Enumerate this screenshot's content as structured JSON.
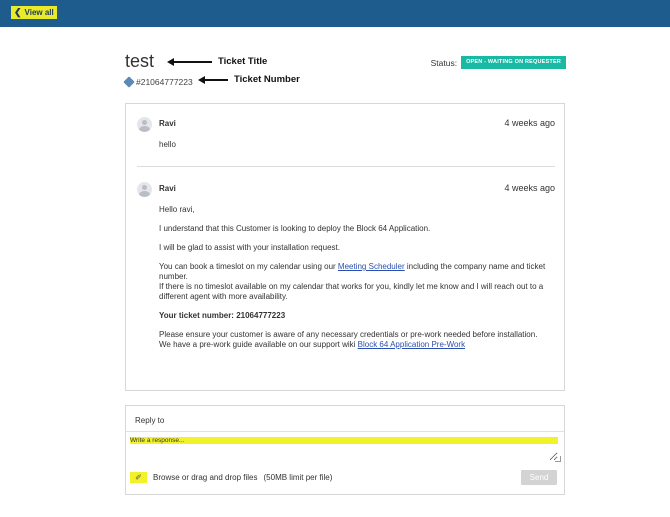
{
  "topbar": {
    "view_all_label": "View all"
  },
  "ticket": {
    "title": "test",
    "number": "#21064777223"
  },
  "annotations": {
    "title_label": "Ticket Title",
    "number_label": "Ticket Number"
  },
  "status": {
    "label": "Status:",
    "badge": "OPEN - WAITING ON REQUESTER",
    "badge_color": "#1ab9a4"
  },
  "messages": [
    {
      "author": "Ravi",
      "time": "4 weeks ago",
      "lines": [
        "hello"
      ]
    },
    {
      "author": "Ravi",
      "time": "4 weeks ago",
      "greeting": "Hello ravi,",
      "p1": "I understand that this Customer is looking to deploy the Block 64 Application.",
      "p2": "I will be glad to assist with your installation request.",
      "p3_pre": "You can book a timeslot on my calendar using our ",
      "p3_link": "Meeting Scheduler",
      "p3_post": " including the company name and ticket number.",
      "p3b": "If there is no timeslot available on my calendar that works for you, kindly let me know and I will reach out to a different agent with more availability.",
      "p4": "Your ticket number: 21064777223",
      "p5": "Please ensure your customer is aware of any necessary credentials or pre-work needed before installation.",
      "p6_pre": "We have a pre-work guide available on our support wiki ",
      "p6_link": "Block 64 Application Pre-Work"
    }
  ],
  "reply": {
    "reply_to_label": "Reply to",
    "placeholder": "Write a response...",
    "attach_text": "Browse or drag and drop files",
    "limit_text": "(50MB limit per file)",
    "send_label": "Send"
  },
  "colors": {
    "topbar": "#1f5c8e",
    "highlight": "#f2f22a",
    "link": "#2a4fb0"
  }
}
